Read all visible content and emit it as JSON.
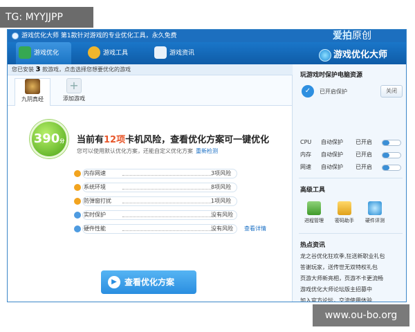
{
  "watermarks": {
    "top_left": "TG: MYYJJPP",
    "bottom_right": "www.ou-bo.org"
  },
  "titlebar": {
    "text": "游戏优化大师 第1款针对游戏的专业优化工具，永久免费",
    "brand": "爱拍",
    "brand_sub": "原创"
  },
  "nav": {
    "items": [
      {
        "label": "游戏优化"
      },
      {
        "label": "游戏工具"
      },
      {
        "label": "游戏资讯"
      }
    ],
    "logo": "游戏优化大师"
  },
  "infobar": {
    "prefix": "您已安装",
    "count": "3",
    "suffix": "款游戏，点击选择您想要优化的游戏"
  },
  "tabs": [
    {
      "label": "九阴真经"
    },
    {
      "label": "添加游戏"
    }
  ],
  "score": {
    "value": "390",
    "unit": "分"
  },
  "headline": {
    "pre": "当前有",
    "highlight": "12项",
    "post": "卡机风险，查看优化方案可一键优化"
  },
  "subline": {
    "text": "您可以使用默认优化方案，还能自定义优化方案",
    "link": "重新检测"
  },
  "risks": [
    {
      "name": "内存网速",
      "value": "3项风险",
      "status": "warn"
    },
    {
      "name": "系统环境",
      "value": "8项风险",
      "status": "warn"
    },
    {
      "name": "防弹窗打扰",
      "value": "1项风险",
      "status": "warn"
    },
    {
      "name": "实时保护",
      "value": "没有风险",
      "status": "ok"
    },
    {
      "name": "硬件性能",
      "value": "没有风险",
      "status": "ok",
      "link": "查看详情"
    }
  ],
  "action_button": "查看优化方案",
  "sidebar": {
    "protect_title": "玩游戏时保护电脑资源",
    "protect_status": "已开启保护",
    "off_button": "关闭",
    "resources": [
      {
        "name": "CPU",
        "mode": "自动保护",
        "state": "已开启"
      },
      {
        "name": "内存",
        "mode": "自动保护",
        "state": "已开启"
      },
      {
        "name": "网速",
        "mode": "自动保护",
        "state": "已开启"
      }
    ],
    "tools_title": "高级工具",
    "tools": [
      {
        "label": "进程管理"
      },
      {
        "label": "密码助手"
      },
      {
        "label": "硬件评测"
      }
    ],
    "news_title": "热点资讯",
    "news": [
      "龙之谷优化狂欢季,狂送新职业礼包",
      "答谢玩家，送传世无双特权礼包",
      "页游大师新亮相，页游不卡更流畅",
      "游戏优化大师论坛版主招募中",
      "加入官方论坛，交流使用体验"
    ]
  },
  "colors": {
    "titlebar": "#1c6fbf",
    "highlight": "#e8562a",
    "score": "#4aa316",
    "button": "#2a8ee0"
  }
}
